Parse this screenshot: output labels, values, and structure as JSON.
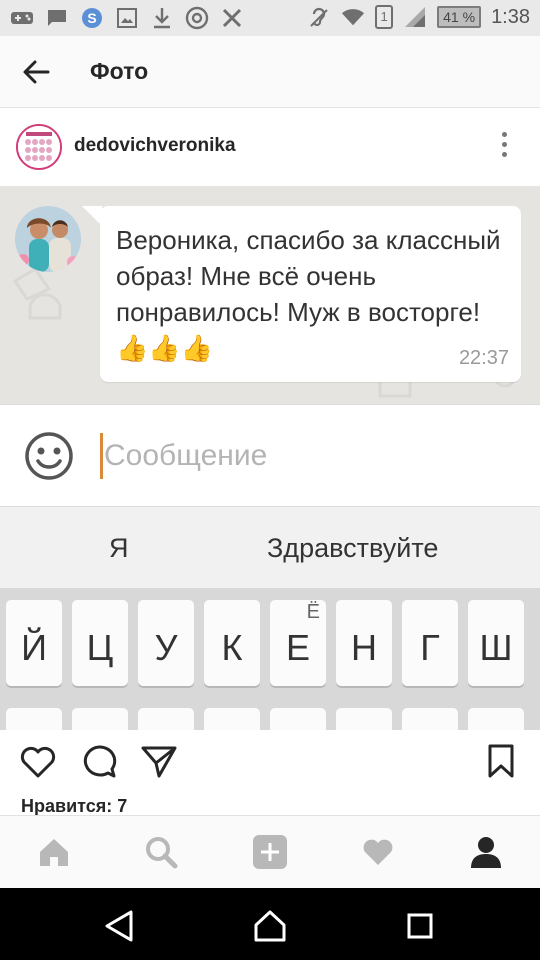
{
  "status_bar": {
    "battery": "41 %",
    "sim": "1",
    "time": "1:38",
    "icons": [
      "gamepad-icon",
      "message-icon",
      "skype-icon",
      "image-icon",
      "download-icon",
      "at-icon",
      "cross-tools-icon",
      "hearing-icon",
      "wifi-icon",
      "signal-icon"
    ]
  },
  "header": {
    "title": "Фото"
  },
  "post": {
    "username": "dedovichveronika"
  },
  "chat": {
    "message": "Вероника, спасибо за классный образ! Мне всё очень понравилось! Муж в восторге!👍👍👍",
    "time": "22:37",
    "placeholder": "Сообщение",
    "suggestions": [
      "Я",
      "Здравствуйте"
    ],
    "keys": [
      "Й",
      "Ц",
      "У",
      "К",
      "Е",
      "Н",
      "Г",
      "Ш"
    ],
    "key_alt": "Ё"
  },
  "likes": "Нравится: 7",
  "colors": {
    "accent": "#3897f0",
    "caret": "#d98a3b",
    "avatar_ring": "#d23c7a"
  }
}
